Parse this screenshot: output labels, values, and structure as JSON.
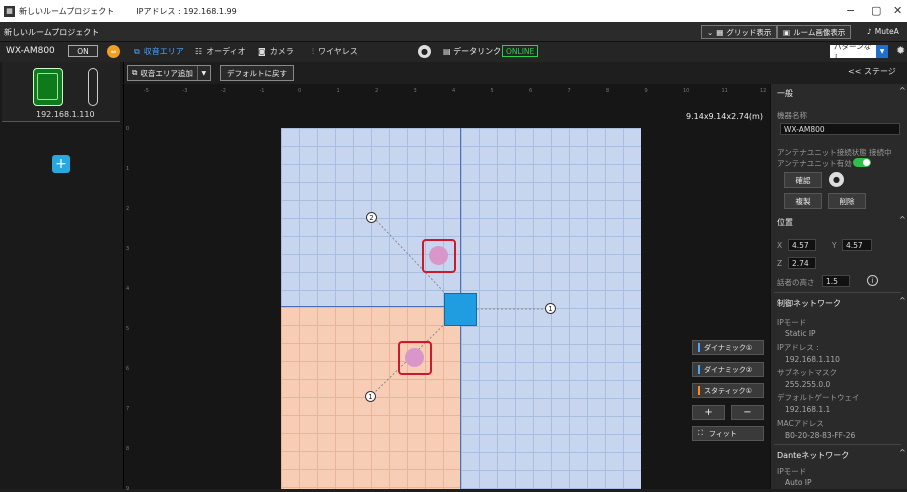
{
  "titlebar": {
    "project": "新しいルームプロジェクト",
    "ip": "IPアドレス : 192.168.1.99",
    "min": "−",
    "max": "▢",
    "close": "✕"
  },
  "bar2": {
    "project_name": "新しいルームプロジェクト",
    "grid_label": "グリッド表示",
    "room_image_label": "ルーム画像表示",
    "mute_label": "MuteA"
  },
  "device": {
    "name": "WX-AM800",
    "status": "ON",
    "ip": "192.168.1.110"
  },
  "nav": {
    "tabs": [
      "収音エリア",
      "オーディオ",
      "カメラ",
      "ワイヤレス"
    ],
    "datalink": "データリンク",
    "online": "ONLINE",
    "pattern": "パターンなし"
  },
  "toolbar": {
    "add_area": "収音エリア追加",
    "reset": "デフォルトに戻す",
    "stage": "<< ステージ"
  },
  "canvas": {
    "dims": "9.14x9.14x2.74(m)",
    "ruler_top": [
      "-5",
      "-3",
      "-2",
      "-1",
      "0",
      "1",
      "2",
      "3",
      "4",
      "5",
      "6",
      "7",
      "8",
      "9",
      "10",
      "11",
      "12"
    ],
    "ruler_left": [
      "0",
      "1",
      "2",
      "3",
      "4",
      "5",
      "6",
      "7",
      "8",
      "9"
    ],
    "labels": {
      "n2": "2",
      "n1a": "1",
      "n1b": "1"
    }
  },
  "legend": {
    "dyn1": "ダイナミック①",
    "dyn2": "ダイナミック②",
    "static1": "スタティック①",
    "plus": "+",
    "minus": "−",
    "fit": "フィット",
    "colors": {
      "dyn1": "#4aa3ff",
      "dyn2": "#4aa3ff",
      "static1": "#ff8a1f"
    }
  },
  "panel": {
    "general": "一般",
    "device_name_label": "機器名称",
    "device_name_value": "WX-AM800",
    "antenna_status": "アンテナユニット接続状態 接続中",
    "antenna_enabled": "アンテナユニット有効",
    "confirm": "確認",
    "duplicate": "複製",
    "delete": "削除",
    "position": "位置",
    "x_label": "X",
    "x_value": "4.57",
    "y_label": "Y",
    "y_value": "4.57",
    "z_label": "Z",
    "z_value": "2.74",
    "speaker_height_label": "話者の高さ",
    "speaker_height_value": "1.5",
    "control_network": "制御ネットワーク",
    "ip_mode_label": "IPモード",
    "ip_mode_value": "Static IP",
    "ip_address_label": "IPアドレス :",
    "ip_address_value": "192.168.1.110",
    "subnet_label": "サブネットマスク",
    "subnet_value": "255.255.0.0",
    "gateway_label": "デフォルトゲートウェイ",
    "gateway_value": "192.168.1.1",
    "mac_label": "MACアドレス",
    "mac_value": "B0-20-28-83-FF-26",
    "dante_network": "Danteネットワーク",
    "dante_ip_mode_label": "IPモード",
    "dante_ip_mode_value": "Auto IP"
  }
}
